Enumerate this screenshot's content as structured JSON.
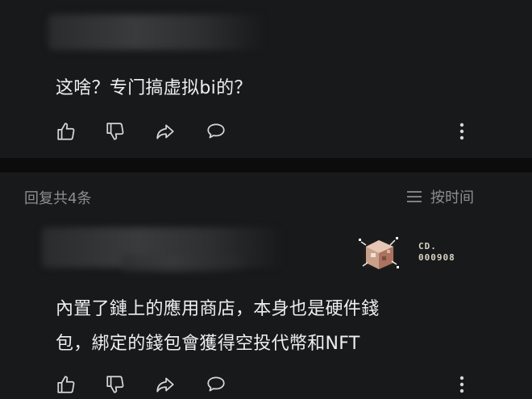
{
  "comments": [
    {
      "text": "这啥？专门搞虚拟bi的？"
    },
    {
      "text_line1": "內置了鏈上的應用商店，本身也是硬件錢",
      "text_line2": "包，綁定的錢包會獲得空投代幣和NFT",
      "badge": {
        "line1": "CD.",
        "line2": "000908"
      }
    }
  ],
  "replies": {
    "count_label": "回复共4条",
    "sort_label": "按时间"
  },
  "icons": {
    "like": "thumbs-up-icon",
    "dislike": "thumbs-down-icon",
    "share": "share-icon",
    "comment": "comment-icon",
    "more": "more-vertical-icon",
    "sort": "sort-lines-icon"
  },
  "colors": {
    "background": "#111213",
    "card": "#18191a",
    "text": "#efefef",
    "muted": "#8d8e90"
  }
}
